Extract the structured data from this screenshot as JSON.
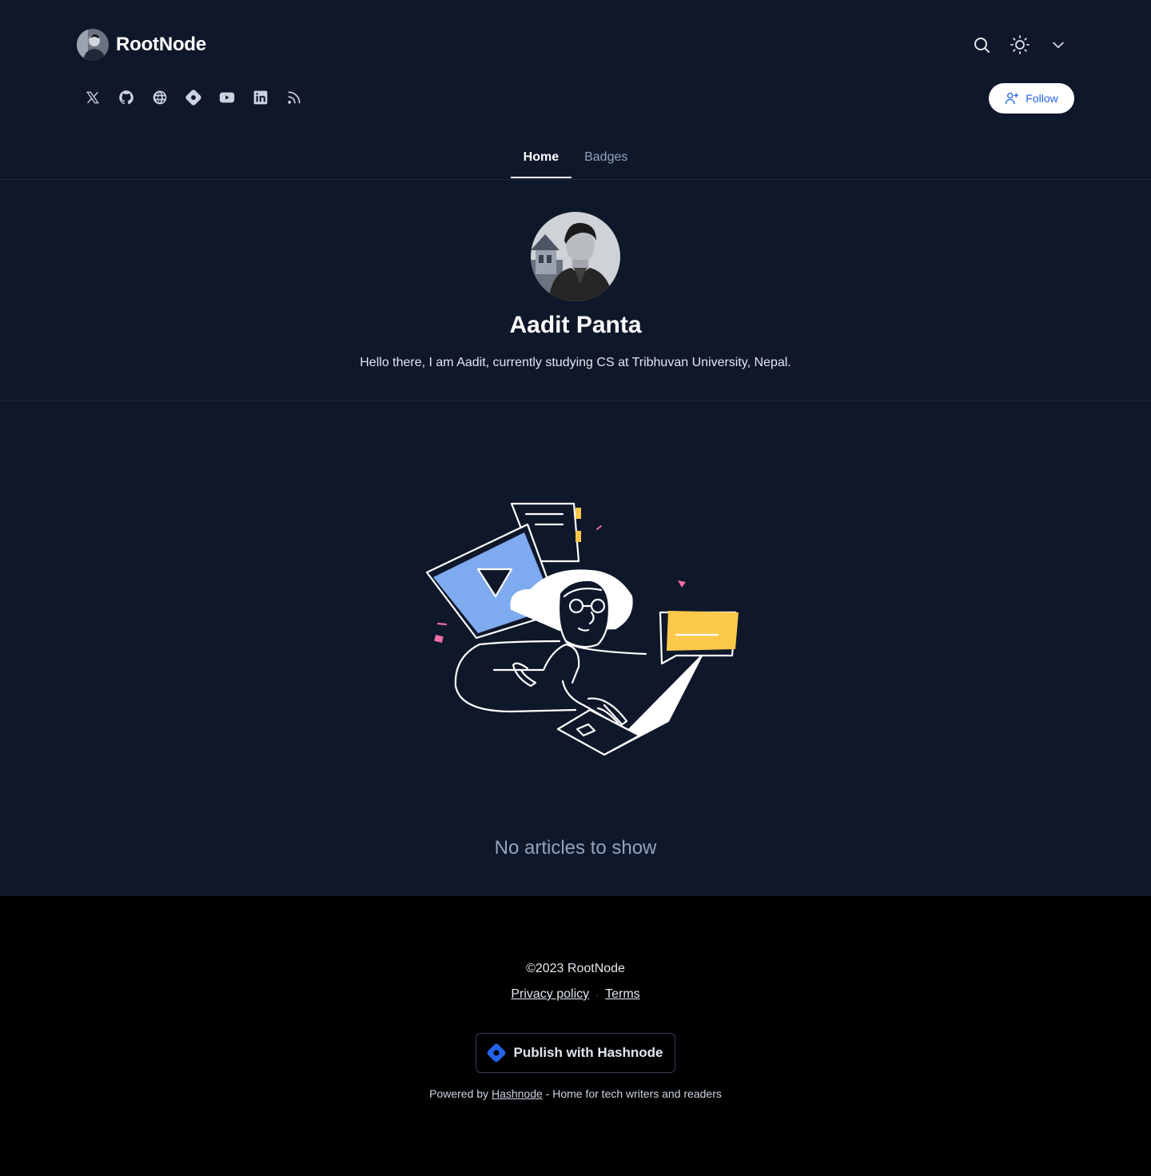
{
  "brand": {
    "name": "RootNode",
    "avatar_icon": "user-photo-icon"
  },
  "header_actions": [
    "search-icon",
    "sun-icon",
    "chevron-down-icon"
  ],
  "socials": [
    "x-icon",
    "github-icon",
    "globe-icon",
    "hashnode-icon",
    "youtube-icon",
    "linkedin-icon",
    "rss-icon"
  ],
  "follow": {
    "label": "Follow",
    "icon": "user-plus-icon"
  },
  "tabs": [
    {
      "label": "Home",
      "active": true
    },
    {
      "label": "Badges",
      "active": false
    }
  ],
  "profile": {
    "name": "Aadit Panta",
    "bio": "Hello there, I am Aadit, currently studying CS at Tribhuvan University, Nepal."
  },
  "empty_state": {
    "message": "No articles to show"
  },
  "footer": {
    "copyright": "©2023 RootNode",
    "privacy": "Privacy policy",
    "separator": "·",
    "terms": "Terms",
    "publish_label": "Publish with Hashnode",
    "powered_prefix": "Powered by",
    "powered_link": "Hashnode",
    "powered_suffix": "- Home for tech writers and readers"
  },
  "colors": {
    "accent": "#2563eb",
    "background": "#0f172a",
    "footer_bg": "#000000",
    "illustration_blue": "#7eaaf0",
    "illustration_yellow": "#fcc84a",
    "illustration_pink": "#ec6ea3"
  }
}
